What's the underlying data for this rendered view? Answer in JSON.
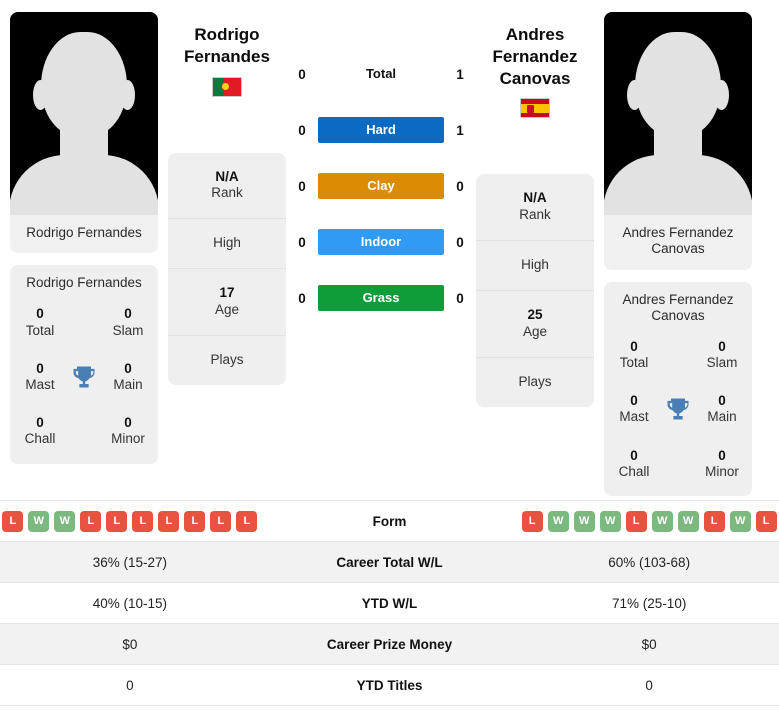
{
  "colors": {
    "hard": "#0b6bc2",
    "clay": "#dc8c04",
    "indoor": "#2f9bf5",
    "grass": "#0f9d3a",
    "win": "#7cb97f",
    "loss": "#e8523f",
    "trophy": "#4a7fb5"
  },
  "players": {
    "left": {
      "name_line1": "Rodrigo",
      "name_line2": "Fernandes",
      "full_name": "Rodrigo Fernandes",
      "photo_caption": "Rodrigo Fernandes",
      "flag": "portugal-flag",
      "titles": {
        "total_value": "0",
        "total_label": "Total",
        "slam_value": "0",
        "slam_label": "Slam",
        "mast_value": "0",
        "mast_label": "Mast",
        "main_value": "0",
        "main_label": "Main",
        "chall_value": "0",
        "chall_label": "Chall",
        "minor_value": "0",
        "minor_label": "Minor"
      },
      "info": {
        "rank_value": "N/A",
        "rank_label": "Rank",
        "high_value": "",
        "high_label": "High",
        "age_value": "17",
        "age_label": "Age",
        "plays_value": "",
        "plays_label": "Plays"
      },
      "form": [
        "L",
        "W",
        "W",
        "L",
        "L",
        "L",
        "L",
        "L",
        "L",
        "L"
      ]
    },
    "right": {
      "name_line1": "Andres",
      "name_line2": "Fernandez",
      "name_line3": "Canovas",
      "full_name": "Andres Fernandez Canovas",
      "photo_caption_line1": "Andres Fernandez",
      "photo_caption_line2": "Canovas",
      "flag": "spain-flag",
      "titles": {
        "total_value": "0",
        "total_label": "Total",
        "slam_value": "0",
        "slam_label": "Slam",
        "mast_value": "0",
        "mast_label": "Mast",
        "main_value": "0",
        "main_label": "Main",
        "chall_value": "0",
        "chall_label": "Chall",
        "minor_value": "0",
        "minor_label": "Minor"
      },
      "info": {
        "rank_value": "N/A",
        "rank_label": "Rank",
        "high_value": "",
        "high_label": "High",
        "age_value": "25",
        "age_label": "Age",
        "plays_value": "",
        "plays_label": "Plays"
      },
      "form": [
        "L",
        "W",
        "W",
        "W",
        "L",
        "W",
        "W",
        "L",
        "W",
        "L"
      ]
    }
  },
  "h2h": [
    {
      "label": "Total",
      "left": "0",
      "right": "1",
      "style": "plain"
    },
    {
      "label": "Hard",
      "left": "0",
      "right": "1",
      "style": "hard"
    },
    {
      "label": "Clay",
      "left": "0",
      "right": "0",
      "style": "clay"
    },
    {
      "label": "Indoor",
      "left": "0",
      "right": "0",
      "style": "indoor"
    },
    {
      "label": "Grass",
      "left": "0",
      "right": "0",
      "style": "grass"
    }
  ],
  "stats_table": {
    "form_label": "Form",
    "rows": [
      {
        "label": "Career Total W/L",
        "left": "36% (15-27)",
        "right": "60% (103-68)"
      },
      {
        "label": "YTD W/L",
        "left": "40% (10-15)",
        "right": "71% (25-10)"
      },
      {
        "label": "Career Prize Money",
        "left": "$0",
        "right": "$0"
      },
      {
        "label": "YTD Titles",
        "left": "0",
        "right": "0"
      }
    ]
  }
}
